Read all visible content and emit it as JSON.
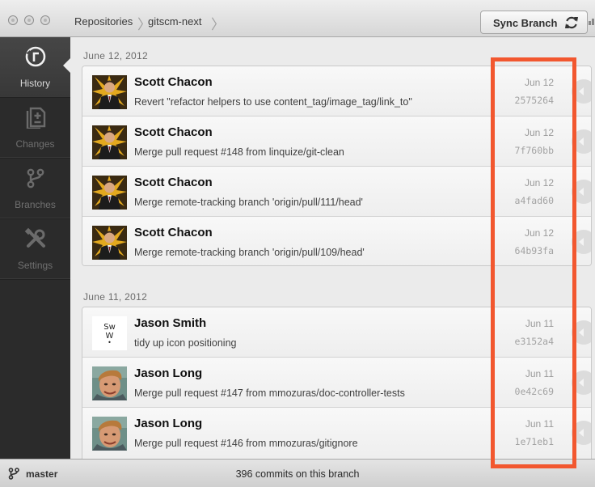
{
  "titlebar": {
    "breadcrumbs": [
      "Repositories",
      "gitscm-next"
    ],
    "sync_button": "Sync Branch",
    "sync_icon": "refresh-icon"
  },
  "sidebar": {
    "items": [
      {
        "label": "History",
        "icon": "history-clock-icon",
        "active": true
      },
      {
        "label": "Changes",
        "icon": "changes-document-icon",
        "active": false
      },
      {
        "label": "Branches",
        "icon": "branch-icon",
        "active": false
      },
      {
        "label": "Settings",
        "icon": "settings-tools-icon",
        "active": false
      }
    ]
  },
  "groups": [
    {
      "date": "June 12, 2012",
      "commits": [
        {
          "author": "Scott Chacon",
          "message": "Revert \"refactor helpers to use content_tag/image_tag/link_to\"",
          "date": "Jun 12",
          "sha": "2575264",
          "avatar": "scott"
        },
        {
          "author": "Scott Chacon",
          "message": "Merge pull request #148 from linquize/git-clean",
          "date": "Jun 12",
          "sha": "7f760bb",
          "avatar": "scott"
        },
        {
          "author": "Scott Chacon",
          "message": "Merge remote-tracking branch 'origin/pull/111/head'",
          "date": "Jun 12",
          "sha": "a4fad60",
          "avatar": "scott"
        },
        {
          "author": "Scott Chacon",
          "message": "Merge remote-tracking branch 'origin/pull/109/head'",
          "date": "Jun 12",
          "sha": "64b93fa",
          "avatar": "scott"
        }
      ]
    },
    {
      "date": "June 11, 2012",
      "commits": [
        {
          "author": "Jason Smith",
          "message": "tidy up icon positioning",
          "date": "Jun 11",
          "sha": "e3152a4",
          "avatar": "sw"
        },
        {
          "author": "Jason Long",
          "message": "Merge pull request #147 from mmozuras/doc-controller-tests",
          "date": "Jun 11",
          "sha": "0e42c69",
          "avatar": "jason-long"
        },
        {
          "author": "Jason Long",
          "message": "Merge pull request #146 from mmozuras/gitignore",
          "date": "Jun 11",
          "sha": "1e71eb1",
          "avatar": "jason-long"
        }
      ]
    }
  ],
  "avatar_sw_text": [
    "Sw",
    "W",
    "•"
  ],
  "footer": {
    "branch": "master",
    "commit_count": "396 commits on this branch"
  },
  "annotation": {
    "color": "#f2572f"
  }
}
